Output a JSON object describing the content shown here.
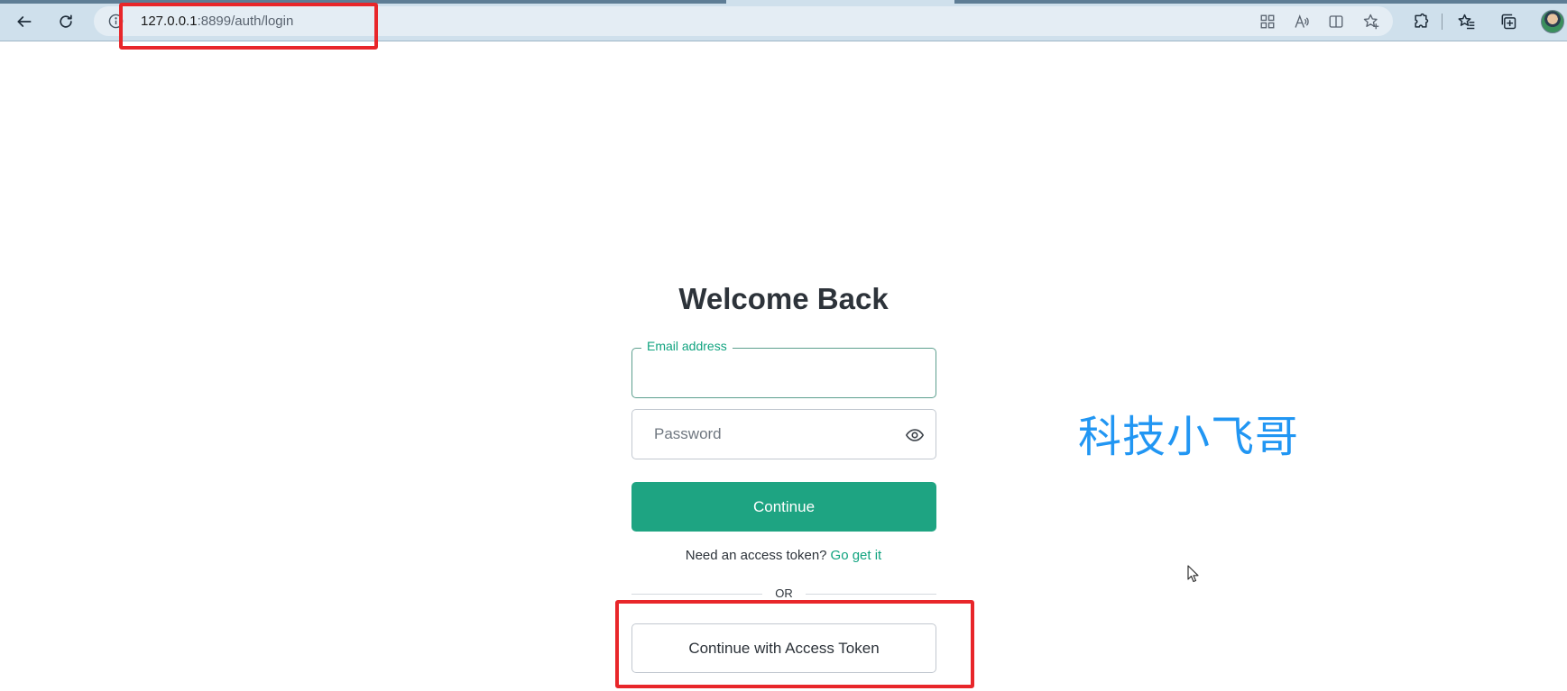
{
  "browser": {
    "url": {
      "host": "127.0.0.1",
      "rest": ":8899/auth/login"
    },
    "icons": {
      "back": "back-arrow-icon",
      "refresh": "refresh-icon",
      "site_info": "info-icon",
      "apps": "apps-icon",
      "read_aloud": "read-aloud-icon",
      "split_screen": "split-screen-icon",
      "add_favorite": "add-favorite-icon",
      "extensions": "extensions-icon",
      "favorites": "favorites-icon",
      "collections": "collections-icon",
      "profile": "profile-avatar"
    }
  },
  "login": {
    "title": "Welcome Back",
    "email_label": "Email address",
    "email_value": "",
    "password_placeholder": "Password",
    "continue_label": "Continue",
    "token_prompt": "Need an access token?",
    "token_link": "Go get it",
    "or_label": "OR",
    "token_button_label": "Continue with Access Token"
  },
  "watermark": {
    "text": "科技小飞哥"
  },
  "colors": {
    "accent": "#10a37f",
    "button": "#1ea482",
    "annotation": "#e8262a",
    "watermark": "#2196f3",
    "toolbar": "#cfe0ec"
  }
}
